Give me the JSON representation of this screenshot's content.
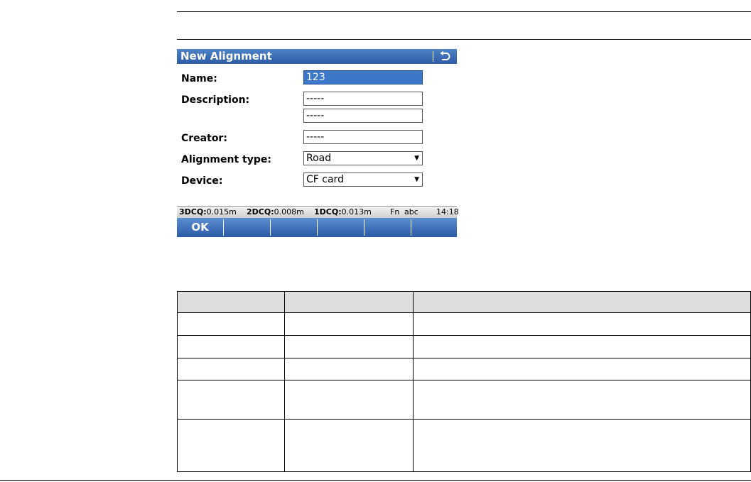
{
  "dialog": {
    "title": "New Alignment",
    "back_icon": "back-arrow-icon",
    "fields": {
      "name": {
        "label": "Name:",
        "value": "123"
      },
      "description": {
        "label": "Description:",
        "value1": "-----",
        "value2": "-----"
      },
      "creator": {
        "label": "Creator:",
        "value": "-----"
      },
      "alignment_type": {
        "label": "Alignment type:",
        "value": "Road"
      },
      "device": {
        "label": "Device:",
        "value": "CF card"
      }
    },
    "status": {
      "q3d_label": "3DCQ:",
      "q3d_value": "0.015m",
      "q2d_label": "2DCQ:",
      "q2d_value": "0.008m",
      "q1d_label": "1DCQ:",
      "q1d_value": "0.013m",
      "fn": "Fn",
      "abc": "abc",
      "time": "14:18"
    },
    "softkeys": [
      "OK",
      "",
      "",
      "",
      "",
      ""
    ]
  },
  "colors": {
    "titlebar": "#3a6db6",
    "selected_field": "#3b78c8",
    "header_row": "#dedede"
  }
}
